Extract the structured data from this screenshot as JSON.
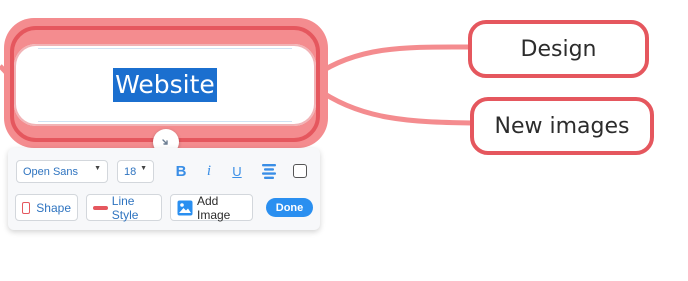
{
  "mindmap": {
    "central_node": {
      "label": "Website"
    },
    "child_nodes": [
      {
        "label": "Design"
      },
      {
        "label": "New images"
      }
    ],
    "accent_color": "#e5575e",
    "selection_color": "#1b6fcf"
  },
  "toolbar": {
    "font_family": "Open Sans",
    "font_size": "18",
    "bold_glyph": "B",
    "italic_glyph": "i",
    "underline_glyph": "U",
    "shape_label": "Shape",
    "line_style_label": "Line Style",
    "add_image_label": "Add Image",
    "done_label": "Done",
    "primary_color": "#2a8ff0"
  },
  "icons": {
    "collapse_toggle": "collapse-icon",
    "align": "align-center-icon",
    "checkbox": "checkbox-icon",
    "shape": "shape-icon",
    "line_style": "line-style-icon",
    "image": "image-icon"
  }
}
